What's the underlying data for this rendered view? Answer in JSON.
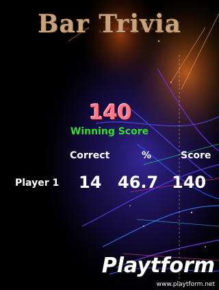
{
  "title": "Bar Trivia",
  "winning": {
    "score": "140",
    "label": "Winning Score"
  },
  "table": {
    "headers": {
      "correct": "Correct",
      "percent": "%",
      "score": "Score"
    },
    "rows": [
      {
        "player": "Player 1",
        "correct": "14",
        "percent": "46.7",
        "score": "140"
      }
    ]
  },
  "watermark": {
    "logo": "Playtform",
    "url": "www.playtform.net"
  },
  "colors": {
    "title": "#c8a27a",
    "winning_score": "#ff7a86",
    "winning_label": "#2ee02e"
  }
}
